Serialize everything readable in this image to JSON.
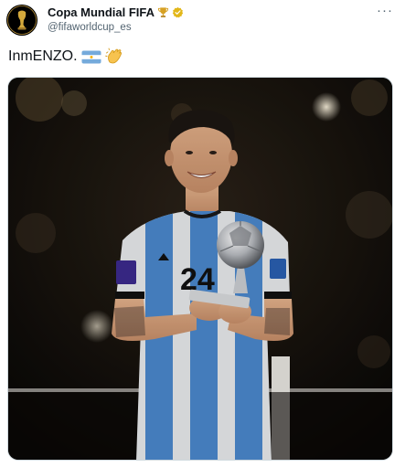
{
  "tweet": {
    "author": {
      "display_name": "Copa Mundial FIFA",
      "handle": "@fifaworldcup_es",
      "verified": true,
      "avatar_icon": "fifa-world-cup-trophy-logo"
    },
    "more_label": "···",
    "text": "InmENZO.",
    "emojis": [
      "argentina-flag-emoji",
      "clapping-hands-emoji"
    ],
    "media": {
      "type": "photo",
      "jersey_number": "24",
      "colors": {
        "sky_blue": "#4e8fd6",
        "gold": "#d4a93c",
        "verified_gold": "#e2b719"
      }
    }
  }
}
